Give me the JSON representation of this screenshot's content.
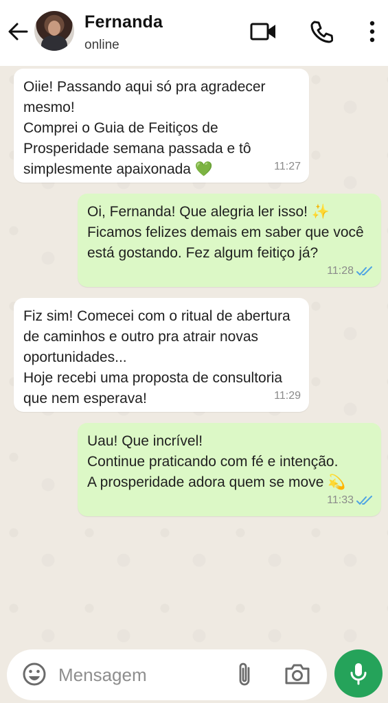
{
  "header": {
    "contact_name": "Fernanda",
    "status": "online",
    "icons": [
      "back-arrow-icon",
      "video-call-icon",
      "phone-icon",
      "more-vert-icon"
    ]
  },
  "messages": [
    {
      "direction": "incoming",
      "text": "Oiie! Passando aqui só pra agradecer mesmo!\nComprei o Guia de Feitiços de Prosperidade semana passada e tô simplesmente apaixonada",
      "emoji": "💚",
      "time": "11:27"
    },
    {
      "direction": "outgoing",
      "text": "Oi, Fernanda! Que alegria ler isso!",
      "text2": "Ficamos felizes demais em saber que você está gostando. Fez algum feitiço já?",
      "emoji": "✨",
      "time": "11:28",
      "ticks": "read"
    },
    {
      "direction": "incoming",
      "text": "Fiz sim! Comecei com o ritual de abertura de caminhos e outro pra atrair novas oportunidades...\nHoje recebi uma proposta de consultoria que nem esperava!",
      "time": "11:29"
    },
    {
      "direction": "outgoing",
      "text": "Uau! Que incrível!\nContinue praticando com fé e intenção.\nA prosperidade adora quem se move",
      "emoji": "💫",
      "time": "11:33",
      "ticks": "read"
    }
  ],
  "composer": {
    "placeholder": "Mensagem",
    "icons": [
      "emoji-icon",
      "attach-icon",
      "camera-icon",
      "mic-icon"
    ]
  },
  "colors": {
    "header_bg": "#ffffff",
    "chat_bg": "#efeae2",
    "incoming_bubble": "#ffffff",
    "outgoing_bubble": "#dcf8c6",
    "mic_button": "#25a35a",
    "read_ticks": "#4fa3e3"
  }
}
